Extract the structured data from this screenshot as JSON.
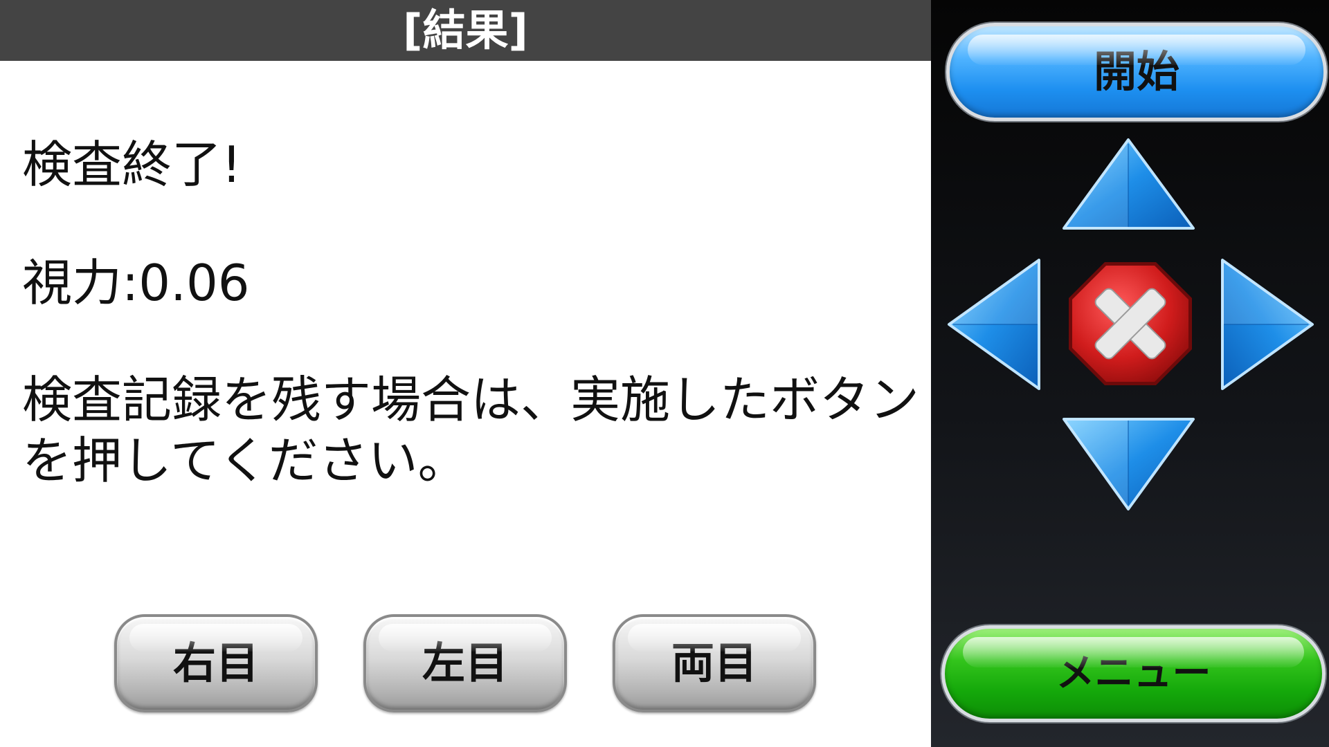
{
  "header": {
    "title": "[結果]"
  },
  "result": {
    "completion": "検査終了!",
    "acuity": "視力:0.06",
    "instruction_line1": "検査記録を残す場合は、実施したボタン",
    "instruction_line2": "を押してください。"
  },
  "eye_buttons": {
    "right_eye": "右目",
    "left_eye": "左目",
    "both_eyes": "両目"
  },
  "controls": {
    "start_label": "開始",
    "menu_label": "メニュー"
  },
  "colors": {
    "title_bar": "#444444",
    "start_button": "#1d8ff0",
    "menu_button": "#14a80a",
    "dpad_arrow": "#1e8ee8",
    "cancel_button": "#d01c1c",
    "panel_background": "#121418"
  },
  "icons": {
    "up": "arrow-up-icon",
    "down": "arrow-down-icon",
    "left": "arrow-left-icon",
    "right": "arrow-right-icon",
    "cancel": "cancel-x-icon"
  }
}
